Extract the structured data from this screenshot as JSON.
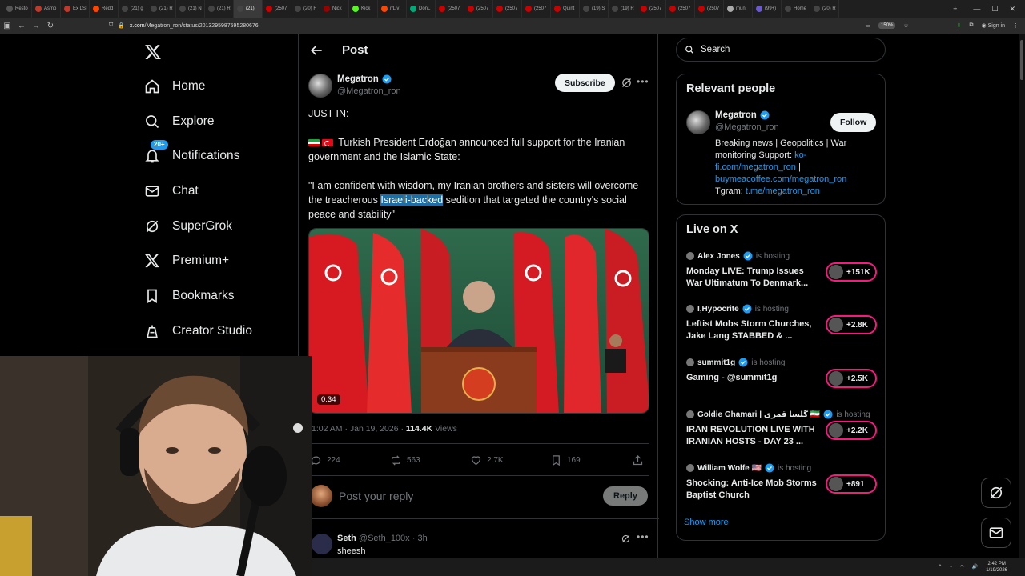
{
  "browser": {
    "tabs": [
      "Resto",
      "Asmo",
      "Ex LSI",
      "Redd",
      "(21) g",
      "(21) R",
      "(21) N",
      "(21) R",
      "(21)",
      "(2507",
      "(20) F",
      "Nick",
      "Kick",
      "r/Liv",
      "DonL",
      "(2507",
      "(2507",
      "(2507",
      "(2507",
      "Quint",
      "(19) S",
      "(19) R",
      "(2507",
      "(2507",
      "(2507",
      "mun",
      "(99+)",
      "Home",
      "(20) R"
    ],
    "active_tab_index": 8,
    "url_host": "x.com",
    "url_path": "/Megatron_ron/status/2013295987595280676",
    "zoom": "150%",
    "sign_in": "Sign in"
  },
  "nav": {
    "items": [
      {
        "label": "Home",
        "icon": "home-icon"
      },
      {
        "label": "Explore",
        "icon": "search-icon"
      },
      {
        "label": "Notifications",
        "icon": "bell-icon"
      },
      {
        "label": "Chat",
        "icon": "mail-icon"
      },
      {
        "label": "SuperGrok",
        "icon": "grok-icon"
      },
      {
        "label": "Premium+",
        "icon": "x-icon"
      },
      {
        "label": "Bookmarks",
        "icon": "bookmark-icon"
      },
      {
        "label": "Creator Studio",
        "icon": "creator-icon"
      }
    ],
    "notif_badge": "20+"
  },
  "post": {
    "header": "Post",
    "author": {
      "name": "Megatron",
      "handle": "@Megatron_ron"
    },
    "subscribe": "Subscribe",
    "text_1": "JUST IN:",
    "text_2": "Turkish President Erdoğan announced full support for the Iranian government and the Islamic State:",
    "quote_before": "\"I am confident with wisdom, my Iranian brothers and sisters will overcome the treacherous ",
    "quote_highlight": "Israeli-backed",
    "quote_after": " sedition that targeted the country's social peace and stability\"",
    "video_duration": "0:34",
    "time": "1:02 AM · Jan 19, 2026 · ",
    "views_count": "114.4K",
    "views_label": " Views",
    "replies": "224",
    "reposts": "563",
    "likes": "2.7K",
    "bookmarks": "169",
    "reply_placeholder": "Post your reply",
    "reply_button": "Reply"
  },
  "comment": {
    "name": "Seth",
    "handle": "@Seth_100x · 3h",
    "text": "sheesh"
  },
  "right": {
    "search_placeholder": "Search",
    "relevant_title": "Relevant people",
    "person": {
      "name": "Megatron",
      "handle": "@Megatron_ron",
      "follow": "Follow",
      "bio_text": "Breaking news | Geopolitics | War monitoring Support: ",
      "bio_link1": "ko-fi.com/megatron_ron",
      "bio_sep": " | ",
      "bio_link2": "buymeacoffee.com/megatron_ron",
      "bio_tgram": " Tgram: ",
      "bio_link3": "t.me/megatron_ron"
    },
    "live_title": "Live on X",
    "hosting_label": "is hosting",
    "live": [
      {
        "host": "Alex Jones",
        "title": "Monday LIVE: Trump Issues War Ultimatum To Denmark...",
        "count": "+151K"
      },
      {
        "host": "I,Hypocrite",
        "title": "Leftist Mobs Storm Churches, Jake Lang STABBED & ...",
        "count": "+2.8K"
      },
      {
        "host": "summit1g",
        "title": "Gaming - @summit1g",
        "count": "+2.5K"
      },
      {
        "host": "Goldie Ghamari | گلسا قمری 🇮🇷",
        "title": "IRAN REVOLUTION LIVE WITH IRANIAN HOSTS - DAY 23 ...",
        "count": "+2.2K"
      },
      {
        "host": "William Wolfe 🇺🇸",
        "title": "Shocking: Anti-Ice Mob Storms Baptist Church",
        "count": "+891"
      }
    ],
    "show_more": "Show more"
  },
  "taskbar": {
    "time": "2:42 PM",
    "date": "1/19/2026"
  },
  "colors": {
    "accent": "#1d9bf0",
    "live": "#f91880",
    "border": "#2f3336",
    "muted": "#71767b"
  }
}
